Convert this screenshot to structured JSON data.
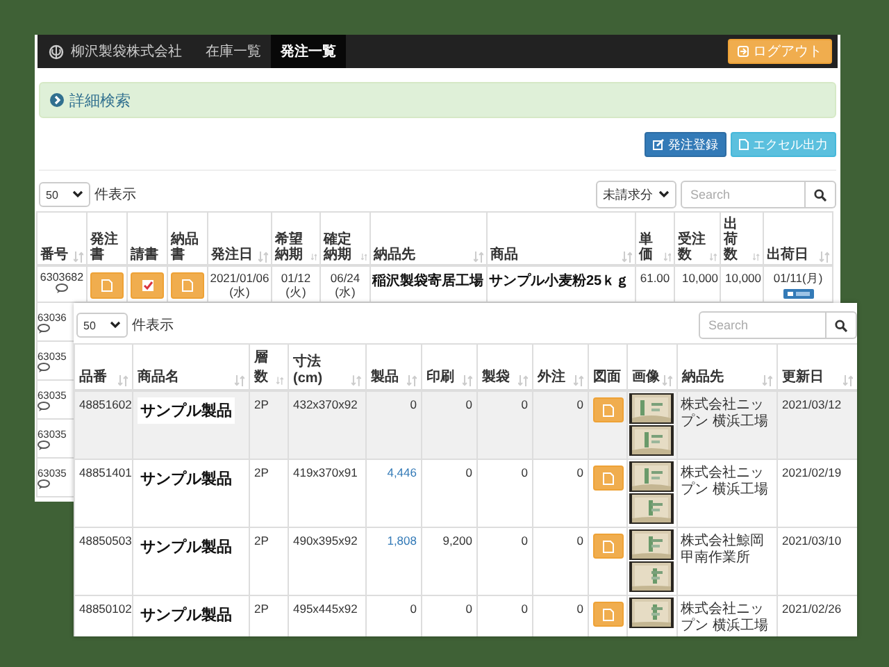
{
  "order_window": {
    "brand": "柳沢製袋株式会社",
    "nav_tabs": [
      {
        "label": "在庫一覧",
        "selected": false
      },
      {
        "label": "発注一覧",
        "selected": true
      }
    ],
    "logout_button": "ログアウト",
    "search_panel": "詳細検索",
    "action_buttons": [
      {
        "label": "発注登録",
        "kind": "primary"
      },
      {
        "label": "エクセル出力",
        "kind": "info"
      }
    ],
    "page_size": "50",
    "page_size_label": "件表示",
    "filter": "未請求分",
    "search": {
      "placeholder": "Search"
    },
    "columns": [
      {
        "label": "番号",
        "sortable": true
      },
      {
        "label": "発注書",
        "sortable": false
      },
      {
        "label": "請書",
        "sortable": false
      },
      {
        "label": "納品書",
        "sortable": false
      },
      {
        "label": "発注日",
        "sortable": true
      },
      {
        "label": "希望納期",
        "sortable": true
      },
      {
        "label": "確定納期",
        "sortable": true
      },
      {
        "label": "納品先",
        "sortable": true
      },
      {
        "label": "商品",
        "sortable": true
      },
      {
        "label": "単価",
        "sortable": true
      },
      {
        "label": "受注数",
        "sortable": true
      },
      {
        "label": "出荷数",
        "sortable": true
      },
      {
        "label": "出荷日",
        "sortable": true
      }
    ],
    "rows": [
      {
        "number": "6303682",
        "documents": [
          {
            "kind": "file"
          },
          {
            "kind": "check"
          },
          {
            "kind": "file"
          }
        ],
        "order_date": "2021/01/06 (水)",
        "desired_date": "01/12 (火)",
        "confirmed_date": "06/24 (水)",
        "destination": "稲沢製袋寄居工場",
        "product": "サンプル小麦粉25ｋｇ",
        "unit_price": "61.00",
        "ordered": "10,000",
        "shipped": "10,000",
        "ship_date": "01/11(月)",
        "tagged": true
      },
      {
        "number": "63036"
      },
      {
        "number": "63035"
      },
      {
        "number": "63035"
      },
      {
        "number": "63035"
      },
      {
        "number": "63035"
      }
    ]
  },
  "product_window": {
    "page_size": "50",
    "page_size_label": "件表示",
    "search": {
      "placeholder": "Search"
    },
    "columns": [
      {
        "label": "品番",
        "sortable": true
      },
      {
        "label": "商品名",
        "sortable": true
      },
      {
        "label": "層数",
        "sortable": true
      },
      {
        "label": "寸法(cm)",
        "sortable": true
      },
      {
        "label": "製品",
        "sortable": true
      },
      {
        "label": "印刷",
        "sortable": true
      },
      {
        "label": "製袋",
        "sortable": true
      },
      {
        "label": "外注",
        "sortable": true
      },
      {
        "label": "図面",
        "sortable": false
      },
      {
        "label": "画像",
        "sortable": true
      },
      {
        "label": "納品先",
        "sortable": true
      },
      {
        "label": "更新日",
        "sortable": true
      }
    ],
    "rows": [
      {
        "code": "48851602",
        "name": "サンプル製品",
        "layers": "2P",
        "size": "432x370x92",
        "product": {
          "value": "0",
          "link": false
        },
        "print": "0",
        "bagging": "0",
        "outsourced": "0",
        "destination": "株式会社ニップン 横浜工場",
        "updated": "2021/03/12",
        "highlighted": true
      },
      {
        "code": "48851401",
        "name": "サンプル製品",
        "layers": "2P",
        "size": "419x370x91",
        "product": {
          "value": "4,446",
          "link": true
        },
        "print": "0",
        "bagging": "0",
        "outsourced": "0",
        "destination": "株式会社ニップン 横浜工場",
        "updated": "2021/02/19",
        "highlighted": false
      },
      {
        "code": "48850503",
        "name": "サンプル製品",
        "layers": "2P",
        "size": "490x395x92",
        "product": {
          "value": "1,808",
          "link": true
        },
        "print": "9,200",
        "bagging": "0",
        "outsourced": "0",
        "destination": "株式会社鯨岡甲南作業所",
        "updated": "2021/03/10",
        "highlighted": false
      },
      {
        "code": "48850102",
        "name": "サンプル製品",
        "layers": "2P",
        "size": "495x445x92",
        "product": {
          "value": "0",
          "link": false
        },
        "print": "0",
        "bagging": "0",
        "outsourced": "0",
        "destination": "株式会社ニップン 横浜工場",
        "updated": "2021/02/26",
        "highlighted": false
      }
    ]
  }
}
